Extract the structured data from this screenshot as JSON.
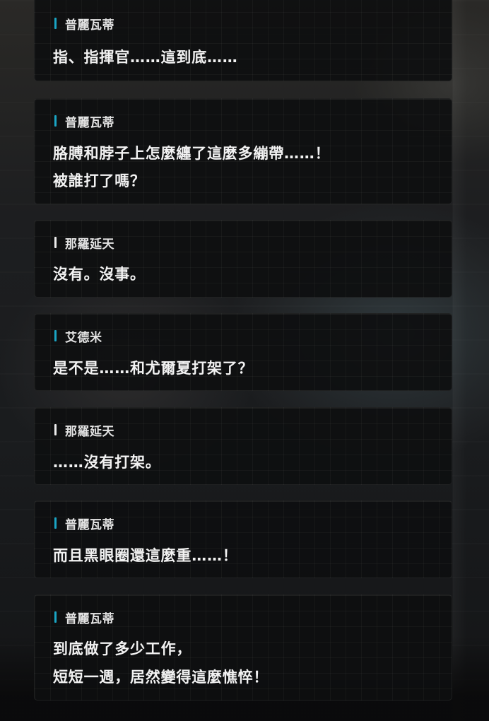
{
  "colors": {
    "accent_cyan": "#1aa5c4",
    "accent_white": "#ececec"
  },
  "dialogue": [
    {
      "speaker": "普麗瓦蒂",
      "accent": "cyan",
      "lines": [
        "指、指揮官……這到底……"
      ]
    },
    {
      "speaker": "普麗瓦蒂",
      "accent": "cyan",
      "lines": [
        "胳膊和脖子上怎麼纏了這麼多繃帶……！",
        "被誰打了嗎？"
      ]
    },
    {
      "speaker": "那羅延天",
      "accent": "white",
      "lines": [
        "沒有。沒事。"
      ]
    },
    {
      "speaker": "艾德米",
      "accent": "cyan",
      "lines": [
        "是不是……和尤爾夏打架了？"
      ]
    },
    {
      "speaker": "那羅延天",
      "accent": "white",
      "lines": [
        "……沒有打架。"
      ]
    },
    {
      "speaker": "普麗瓦蒂",
      "accent": "cyan",
      "lines": [
        "而且黑眼圈還這麼重……！"
      ]
    },
    {
      "speaker": "普麗瓦蒂",
      "accent": "cyan",
      "lines": [
        "到底做了多少工作，",
        "短短一週，居然變得這麼憔悴！"
      ]
    }
  ]
}
